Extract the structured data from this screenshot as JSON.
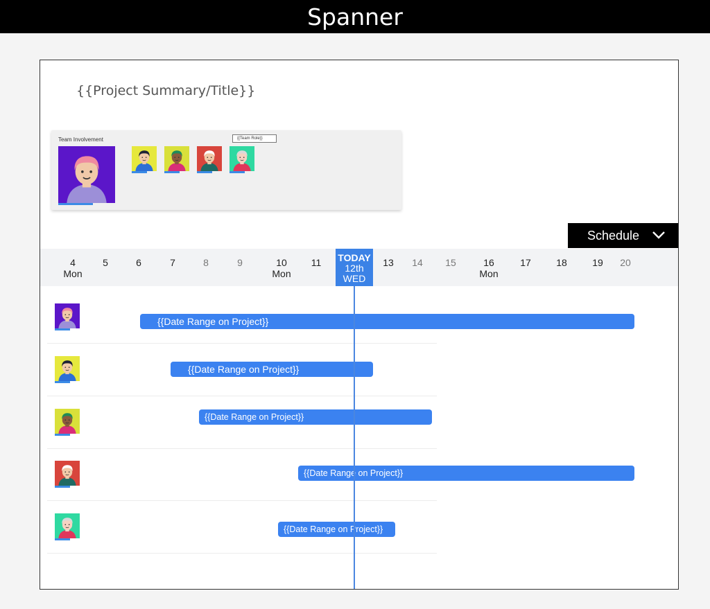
{
  "app": {
    "title": "Spanner"
  },
  "project": {
    "title": "{{Project Summary/Title}}"
  },
  "team": {
    "label": "Team Involvement",
    "role_tooltip": "{{Team Role}}",
    "members": [
      {
        "name": "member-1",
        "bg": "#5b16c9",
        "hair": "#f08aa0",
        "shirt": "#9c8fd8",
        "skin": "#f1c9a8"
      },
      {
        "name": "member-2",
        "bg": "#e6e83d",
        "hair": "#1e2235",
        "shirt": "#2d6fd6",
        "skin": "#f1c9a8"
      },
      {
        "name": "member-3",
        "bg": "#d9e03a",
        "hair": "#1f8a58",
        "shirt": "#d92e78",
        "skin": "#8a5a3c"
      },
      {
        "name": "member-4",
        "bg": "#d8453c",
        "hair": "#ffffff",
        "shirt": "#1f6a63",
        "skin": "#f1c9a8"
      },
      {
        "name": "member-5",
        "bg": "#2fd9a1",
        "hair": "#d9d9d9",
        "shirt": "#e0375b",
        "skin": "#f4d2c2"
      }
    ]
  },
  "schedule": {
    "label": "Schedule"
  },
  "timeline": {
    "days": [
      {
        "num": "4",
        "wk": "Mon",
        "muted": false
      },
      {
        "num": "5",
        "wk": "",
        "muted": false
      },
      {
        "num": "6",
        "wk": "",
        "muted": false
      },
      {
        "num": "7",
        "wk": "",
        "muted": false
      },
      {
        "num": "8",
        "wk": "",
        "muted": true
      },
      {
        "num": "9",
        "wk": "",
        "muted": true
      },
      {
        "num": "10",
        "wk": "Mon",
        "muted": false
      },
      {
        "num": "11",
        "wk": "",
        "muted": false
      },
      {
        "num": "13",
        "wk": "",
        "muted": false
      },
      {
        "num": "14",
        "wk": "",
        "muted": true
      },
      {
        "num": "15",
        "wk": "",
        "muted": true
      },
      {
        "num": "16",
        "wk": "Mon",
        "muted": false
      },
      {
        "num": "17",
        "wk": "",
        "muted": false
      },
      {
        "num": "18",
        "wk": "",
        "muted": false
      },
      {
        "num": "19",
        "wk": "",
        "muted": false
      },
      {
        "num": "20",
        "wk": "",
        "muted": true
      }
    ],
    "today": {
      "line1": "TODAY",
      "line2": "12th",
      "line3": "WED"
    }
  },
  "rows": [
    {
      "label": "{{Date Range on Project}}"
    },
    {
      "label": "{{Date Range on Project}}"
    },
    {
      "label": "{{Date Range on Project}}"
    },
    {
      "label": "{{Date Range on Project}}"
    },
    {
      "label": "{{Date Range on Project}}"
    }
  ],
  "colors": {
    "accent": "#3b82f0",
    "topbar": "#000000"
  }
}
